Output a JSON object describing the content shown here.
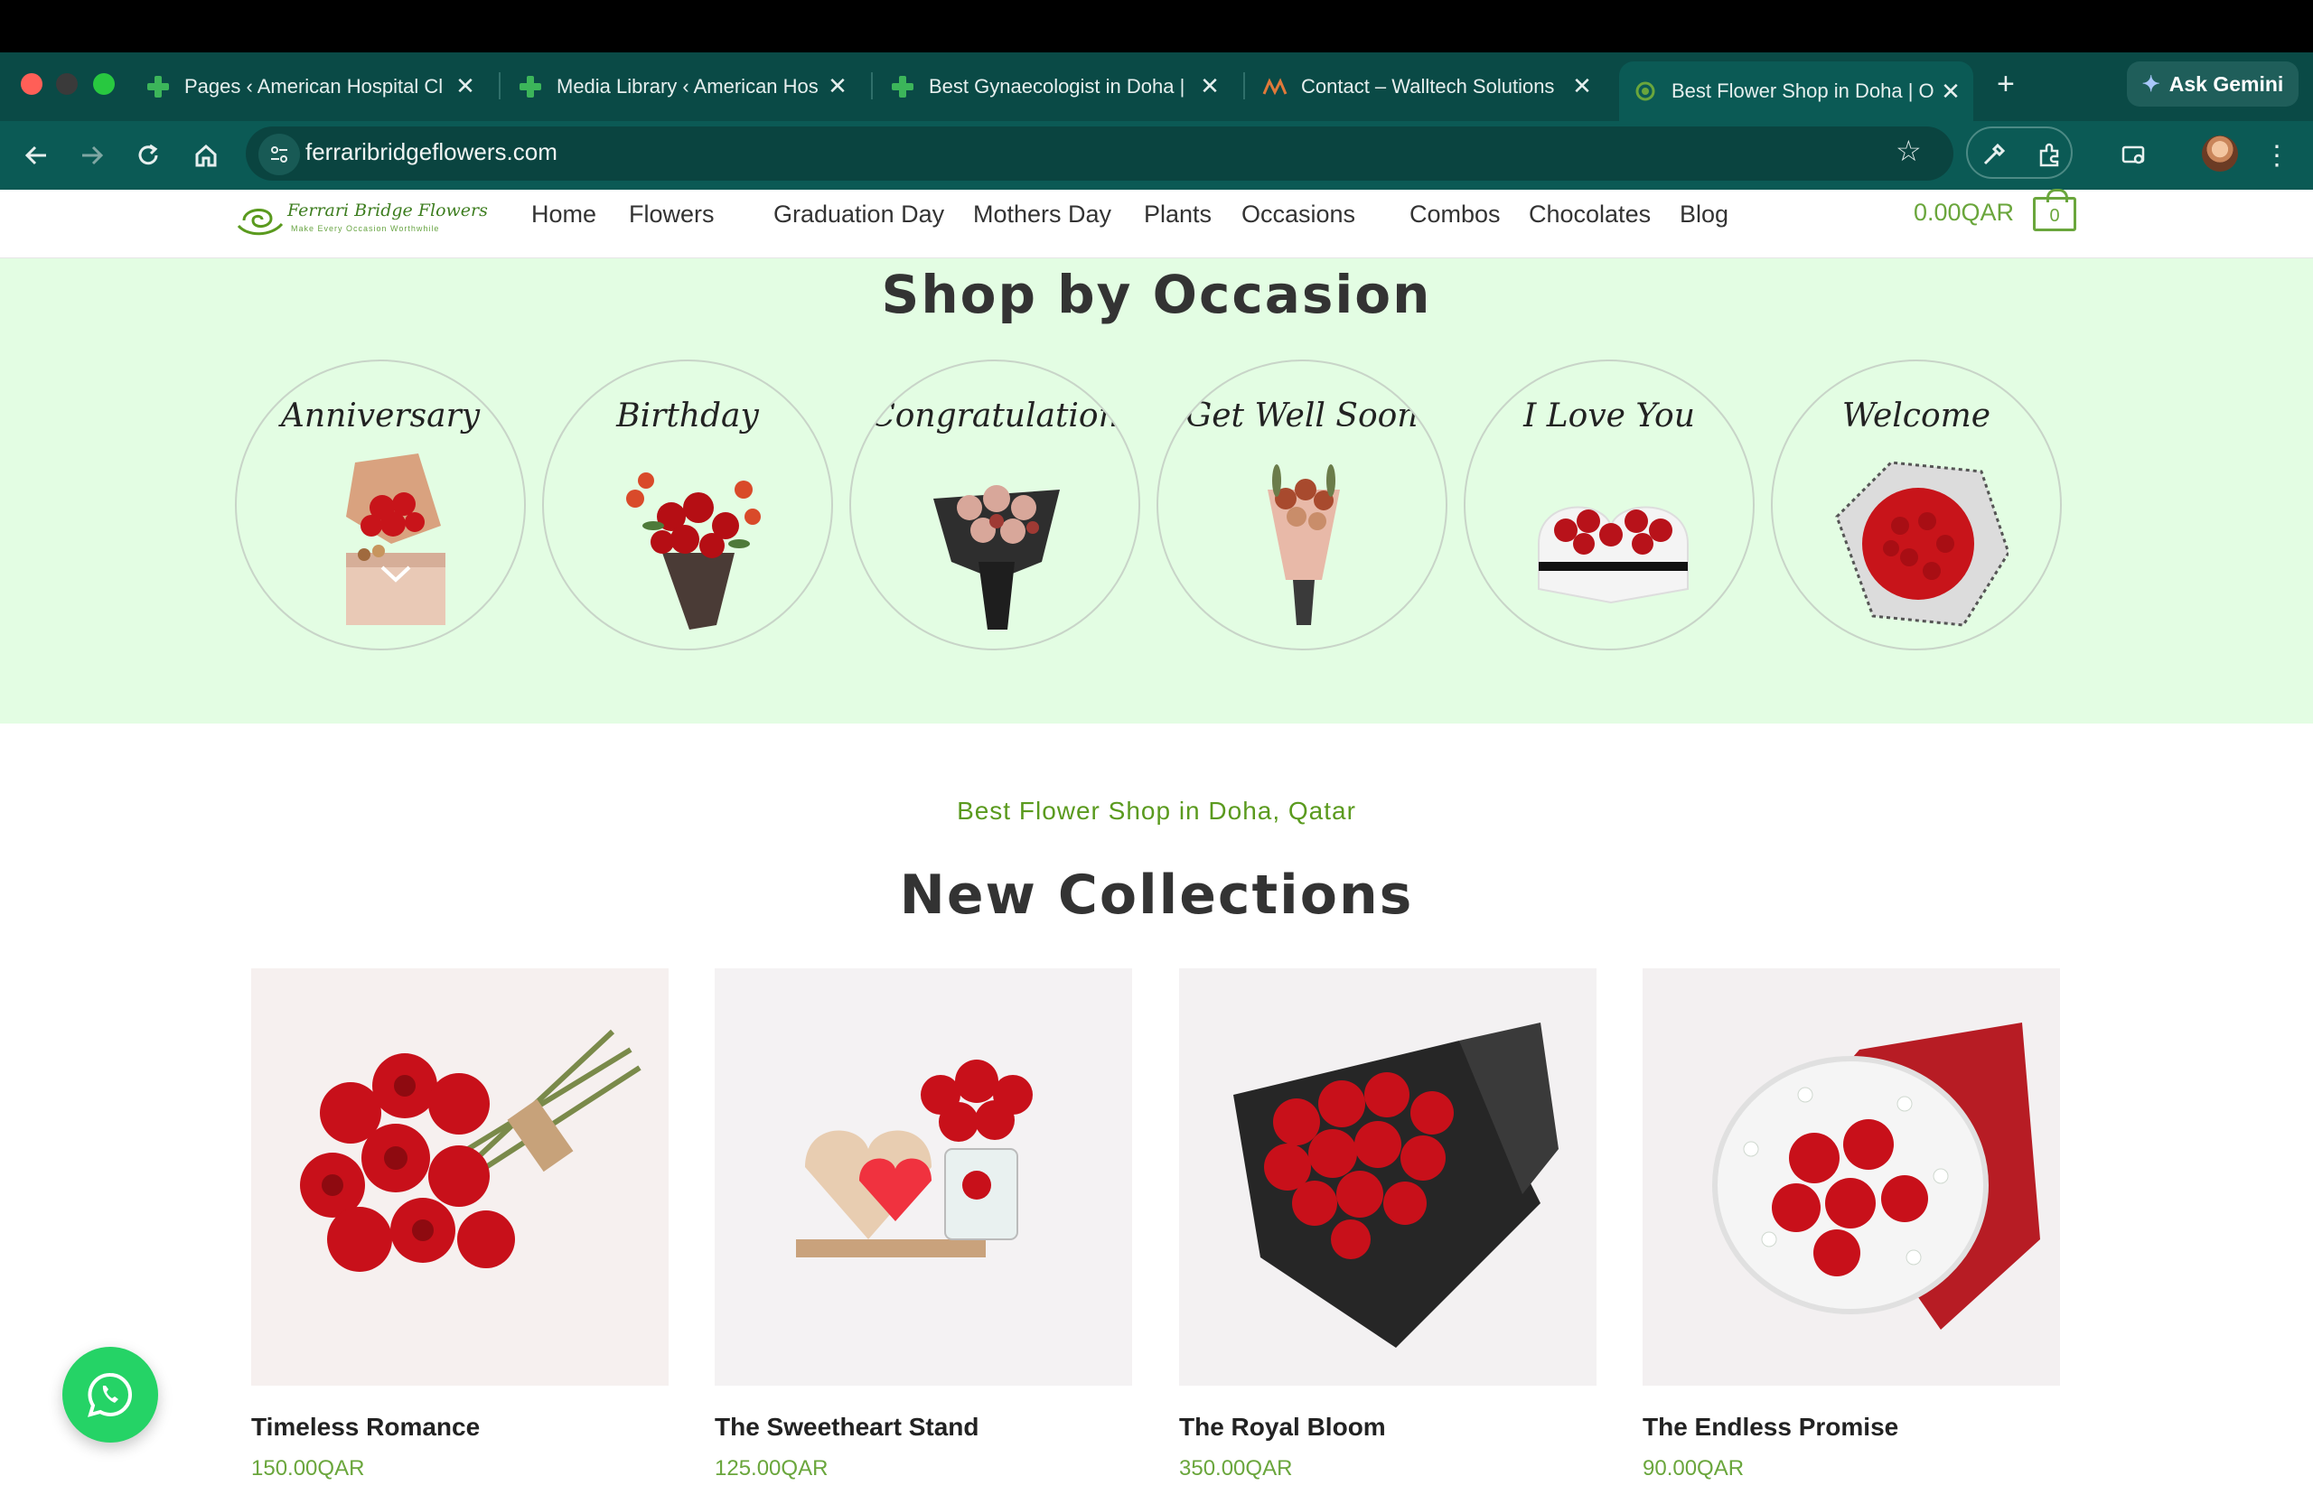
{
  "browser": {
    "tabs": [
      {
        "title": "Pages ‹ American Hospital Cl",
        "icon": "green-cross-icon",
        "active": false
      },
      {
        "title": "Media Library ‹ American Hos",
        "icon": "green-cross-icon",
        "active": false
      },
      {
        "title": "Best Gynaecologist in Doha |",
        "icon": "green-cross-icon",
        "active": false
      },
      {
        "title": "Contact – Walltech Solutions",
        "icon": "walltech-icon",
        "active": false
      },
      {
        "title": "Best Flower Shop in Doha | O",
        "icon": "ferrari-bridge-flowers-icon",
        "active": true
      }
    ],
    "new_tab": "+",
    "close_glyph": "✕",
    "gemini_label": "Ask Gemini",
    "url": "ferraribridgeflowers.com"
  },
  "site": {
    "logo": {
      "brand": "Ferrari Bridge Flowers",
      "tagline": "Make Every Occasion Worthwhile"
    },
    "nav": [
      "Home",
      "Flowers",
      "Graduation Day",
      "Mothers Day",
      "Plants",
      "Occasions",
      "Combos",
      "Chocolates",
      "Blog"
    ],
    "cart": {
      "total": "0.00QAR",
      "count": "0"
    }
  },
  "occasions": {
    "title": "Shop by Occasion",
    "items": [
      {
        "label": "Anniversary"
      },
      {
        "label": "Birthday"
      },
      {
        "label": "Congratulation"
      },
      {
        "label": "Get Well Soon"
      },
      {
        "label": "I Love You"
      },
      {
        "label": "Welcome"
      }
    ]
  },
  "collections": {
    "kicker": "Best Flower Shop in Doha, Qatar",
    "title": "New Collections",
    "products": [
      {
        "name": "Timeless Romance",
        "price": "150.00QAR"
      },
      {
        "name": "The Sweetheart Stand",
        "price": "125.00QAR"
      },
      {
        "name": "The Royal Bloom",
        "price": "350.00QAR"
      },
      {
        "name": "The Endless Promise",
        "price": "90.00QAR"
      }
    ]
  },
  "colors": {
    "accent": "#6aa63c",
    "occasion_bg": "#e3fde3",
    "chrome": "#0b5a55",
    "rose": "#d01a1a"
  }
}
